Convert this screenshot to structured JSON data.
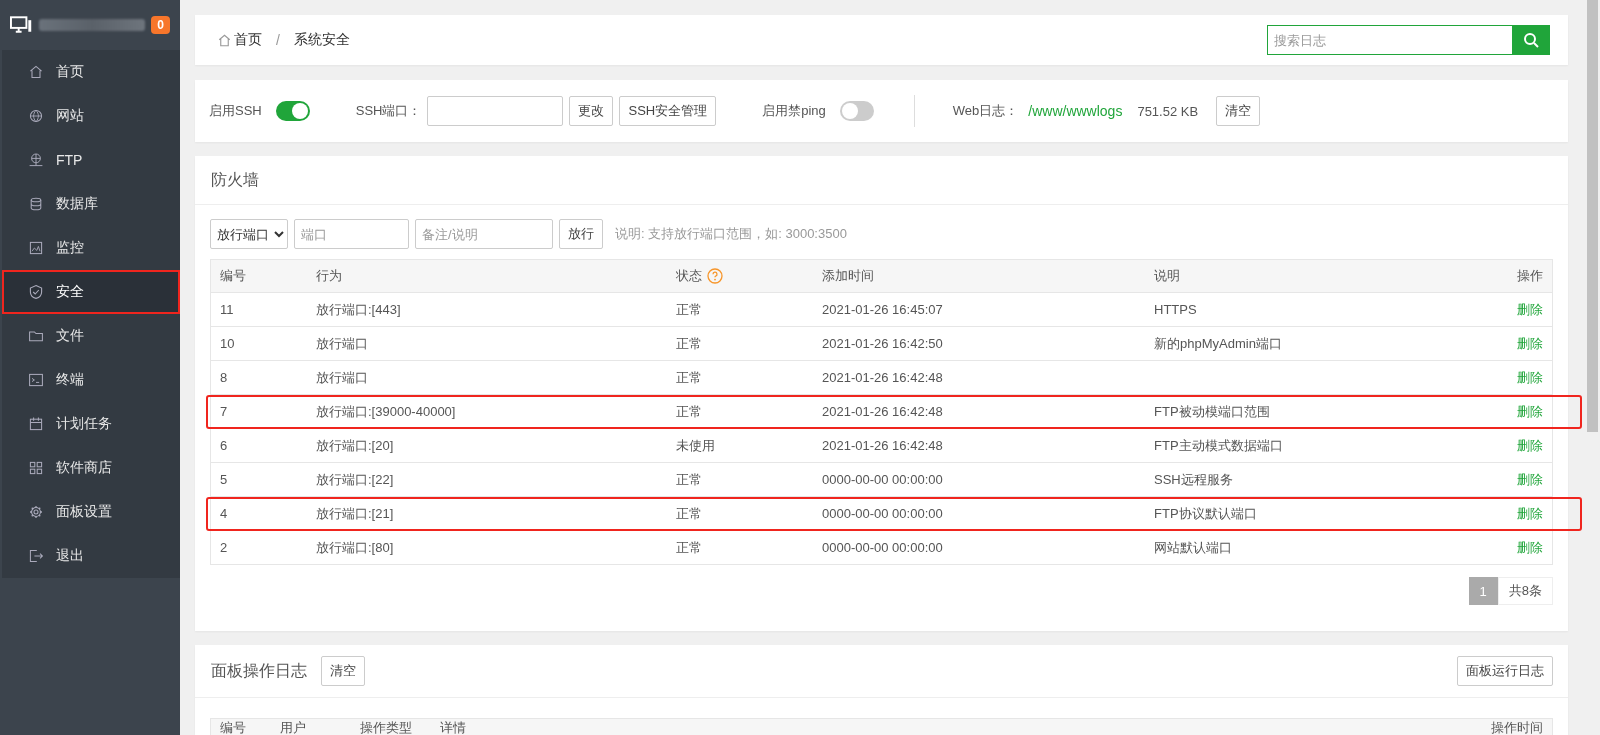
{
  "sidebar": {
    "badge": "0",
    "items": [
      {
        "label": "首页",
        "selected": false,
        "annotated": false
      },
      {
        "label": "网站",
        "selected": false,
        "annotated": false
      },
      {
        "label": "FTP",
        "selected": false,
        "annotated": false
      },
      {
        "label": "数据库",
        "selected": false,
        "annotated": false
      },
      {
        "label": "监控",
        "selected": false,
        "annotated": false
      },
      {
        "label": "安全",
        "selected": true,
        "annotated": true
      },
      {
        "label": "文件",
        "selected": false,
        "annotated": false
      },
      {
        "label": "终端",
        "selected": false,
        "annotated": false
      },
      {
        "label": "计划任务",
        "selected": false,
        "annotated": false
      },
      {
        "label": "软件商店",
        "selected": false,
        "annotated": false
      },
      {
        "label": "面板设置",
        "selected": false,
        "annotated": false
      },
      {
        "label": "退出",
        "selected": false,
        "annotated": false
      }
    ]
  },
  "breadcrumb": {
    "items": [
      "首页",
      "系统安全"
    ],
    "separator": "/"
  },
  "search": {
    "placeholder": "搜索日志"
  },
  "toolbar": {
    "ssh": {
      "label": "启用SSH",
      "on": true
    },
    "ssh_port": {
      "label": "SSH端口："
    },
    "ssh_buttons": [
      "更改",
      "SSH安全管理"
    ],
    "ping": {
      "label": "启用禁ping",
      "on": false
    },
    "web_log": {
      "label": "Web日志：",
      "path": "/www/wwwlogs",
      "size": "751.52 KB",
      "button": "清空"
    }
  },
  "firewall": {
    "title": "防火墙",
    "select": "放行端口",
    "port_placeholder": "端口",
    "note_placeholder": "备注/说明",
    "button": "放行",
    "hint": "说明: 支持放行端口范围，如: 3000:3500",
    "columns": [
      "编号",
      "行为",
      "状态",
      "添加时间",
      "说明",
      "操作"
    ],
    "rows": [
      {
        "id": "11",
        "action": "放行端口:[443]",
        "status": "正常",
        "time": "2021-01-26 16:45:07",
        "note": "HTTPS",
        "op": "删除",
        "annotated": false
      },
      {
        "id": "10",
        "action": "放行端口",
        "status": "正常",
        "time": "2021-01-26 16:42:50",
        "note": "新的phpMyAdmin端口",
        "op": "删除",
        "annotated": false
      },
      {
        "id": "8",
        "action": "放行端口",
        "status": "正常",
        "time": "2021-01-26 16:42:48",
        "note": "",
        "op": "删除",
        "annotated": false
      },
      {
        "id": "7",
        "action": "放行端口:[39000-40000]",
        "status": "正常",
        "time": "2021-01-26 16:42:48",
        "note": "FTP被动模端口范围",
        "op": "删除",
        "annotated": true
      },
      {
        "id": "6",
        "action": "放行端口:[20]",
        "status": "未使用",
        "time": "2021-01-26 16:42:48",
        "note": "FTP主动模式数据端口",
        "op": "删除",
        "annotated": false
      },
      {
        "id": "5",
        "action": "放行端口:[22]",
        "status": "正常",
        "time": "0000-00-00 00:00:00",
        "note": "SSH远程服务",
        "op": "删除",
        "annotated": false
      },
      {
        "id": "4",
        "action": "放行端口:[21]",
        "status": "正常",
        "time": "0000-00-00 00:00:00",
        "note": "FTP协议默认端口",
        "op": "删除",
        "annotated": true
      },
      {
        "id": "2",
        "action": "放行端口:[80]",
        "status": "正常",
        "time": "0000-00-00 00:00:00",
        "note": "网站默认端口",
        "op": "删除",
        "annotated": false
      }
    ],
    "pagination": {
      "pages": [
        {
          "label": "1",
          "selected": true
        }
      ],
      "total": "共8条"
    }
  },
  "panel_log": {
    "title": "面板操作日志",
    "button": "清空",
    "right_button": "面板运行日志",
    "columns": [
      "编号",
      "用户",
      "操作类型",
      "详情",
      "操作时间"
    ]
  }
}
